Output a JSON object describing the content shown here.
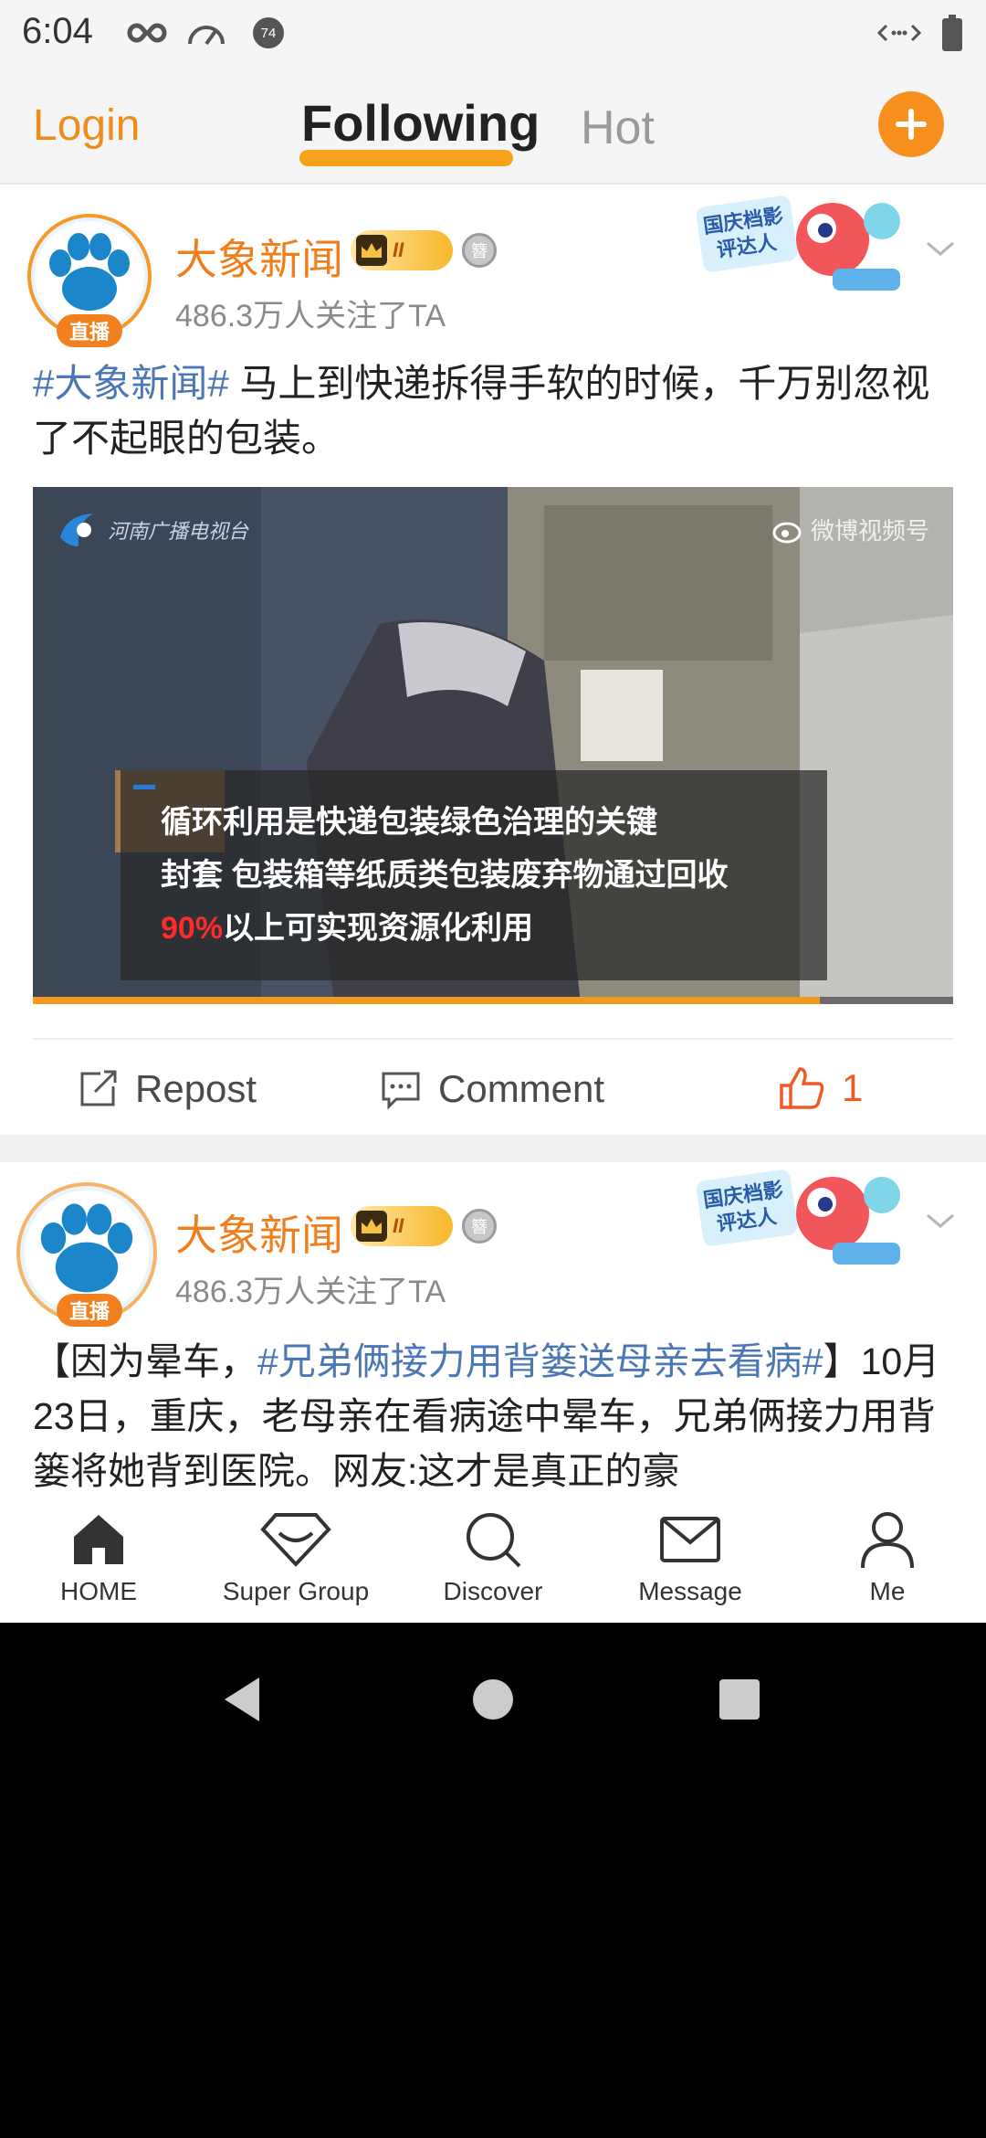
{
  "status_bar": {
    "time": "6:04",
    "icons": [
      "infinity-icon",
      "speedometer-icon",
      "notification-74-icon",
      "data-transfer-icon",
      "battery-icon"
    ],
    "notif_count": "74"
  },
  "top_nav": {
    "login": "Login",
    "following": "Following",
    "hot": "Hot",
    "add_icon": "plus-icon",
    "accent": "#f7901e"
  },
  "posts": [
    {
      "author": "大象新闻",
      "live_badge": "直播",
      "crown_rank": "II",
      "medal_text": "簪",
      "followers": "486.3万人关注了TA",
      "sticker": "国庆档影评达人",
      "text_tag": "#大象新闻#",
      "text_body": " 马上到快递拆得手软的时候，千万别忽视了不起眼的包装。",
      "video": {
        "logo_text": "河南广播电视台",
        "watermark": "微博视频号",
        "caption_line1": "循环利用是快递包装绿色治理的关键",
        "caption_line2": "封套 包装箱等纸质类包装废弃物通过回收",
        "caption_highlight": "90%",
        "caption_line3": "以上可实现资源化利用",
        "progress": 0.855
      },
      "actions": {
        "repost": "Repost",
        "comment": "Comment",
        "like_count": "1"
      }
    },
    {
      "author": "大象新闻",
      "live_badge": "直播",
      "crown_rank": "II",
      "medal_text": "簪",
      "followers": "486.3万人关注了TA",
      "sticker": "国庆档影评达人",
      "text_prefix": "【因为晕车，",
      "text_tag": "#兄弟俩接力用背篓送母亲去看病#",
      "text_suffix": "】",
      "text_body": "10月23日，重庆，老母亲在看病途中晕车，兄弟俩接力用背篓将她背到医院。网友:这才是真正的豪"
    }
  ],
  "tab_bar": {
    "tabs": [
      {
        "label": "HOME",
        "icon": "home-icon"
      },
      {
        "label": "Super Group",
        "icon": "diamond-icon"
      },
      {
        "label": "Discover",
        "icon": "search-icon"
      },
      {
        "label": "Message",
        "icon": "mail-icon"
      },
      {
        "label": "Me",
        "icon": "person-icon"
      }
    ]
  },
  "system_nav": {
    "icons": [
      "back-icon",
      "home-circle-icon",
      "recents-icon"
    ]
  }
}
